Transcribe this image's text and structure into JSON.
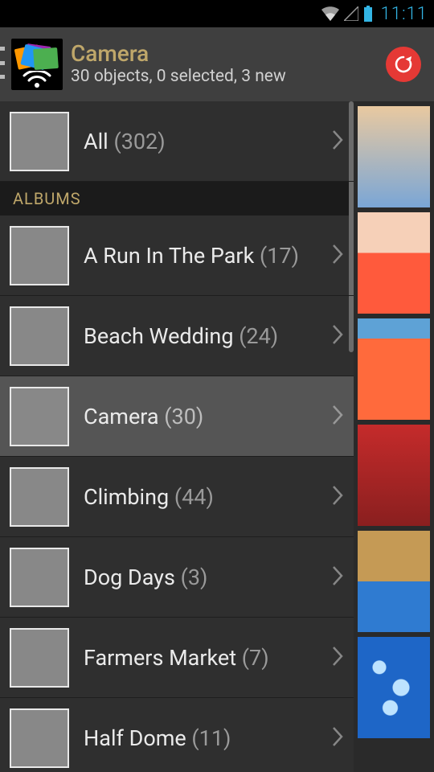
{
  "status": {
    "time": "11:11"
  },
  "actionbar": {
    "title": "Camera",
    "subtitle": "30 objects, 0 selected, 3 new"
  },
  "top_row": {
    "label": "All",
    "count": "(302)"
  },
  "section_label": "ALBUMS",
  "albums": [
    {
      "label": "A Run In The Park",
      "count": "(17)",
      "thumb_class": "ph-dog",
      "selected": false
    },
    {
      "label": "Beach Wedding",
      "count": "(24)",
      "thumb_class": "ph-beach",
      "selected": false
    },
    {
      "label": "Camera",
      "count": "(30)",
      "thumb_class": "ph-cam",
      "selected": true
    },
    {
      "label": "Climbing",
      "count": "(44)",
      "thumb_class": "ph-climb",
      "selected": false
    },
    {
      "label": "Dog Days",
      "count": "(3)",
      "thumb_class": "ph-lake",
      "selected": false
    },
    {
      "label": "Farmers Market",
      "count": "(7)",
      "thumb_class": "ph-market",
      "selected": false
    },
    {
      "label": "Half Dome",
      "count": "(11)",
      "thumb_class": "ph-sunset",
      "selected": false
    }
  ],
  "strip_thumbs": [
    "sp-1",
    "sp-2",
    "sp-3",
    "sp-4",
    "sp-5",
    "sp-6"
  ]
}
